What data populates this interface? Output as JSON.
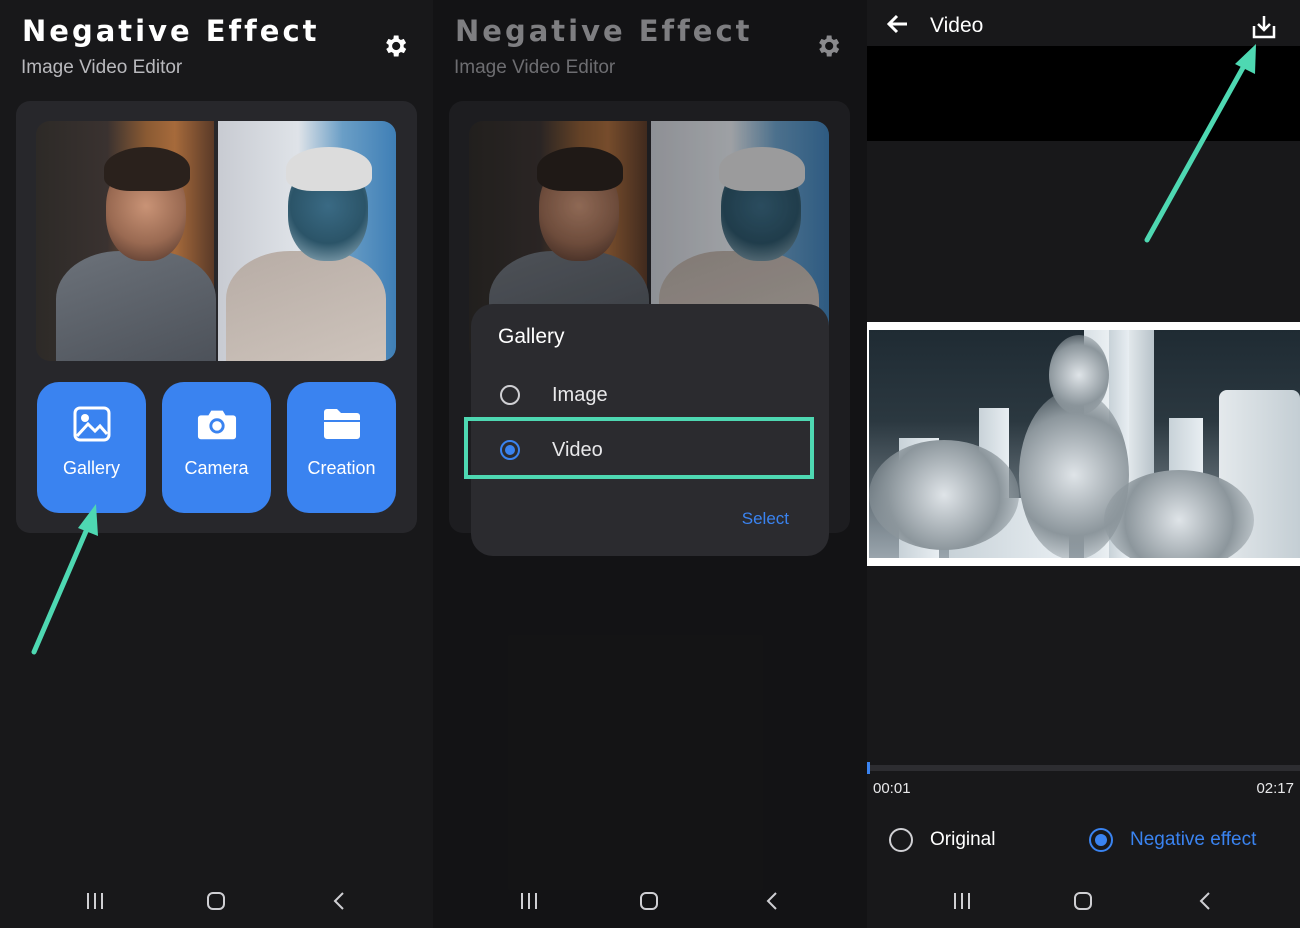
{
  "home": {
    "title": "Negative Effect",
    "subtitle": "Image Video Editor",
    "buttons": [
      "Gallery",
      "Camera",
      "Creation"
    ]
  },
  "dialog": {
    "title": "Gallery",
    "options": [
      "Image",
      "Video"
    ],
    "selected": "Video",
    "action": "Select"
  },
  "player": {
    "title": "Video",
    "current_time": "00:01",
    "total_time": "02:17",
    "progress": 0.008,
    "options": [
      "Original",
      "Negative effect"
    ],
    "selected": "Negative effect"
  },
  "colors": {
    "accent": "#3a83f0",
    "highlight": "#4ed8b2",
    "background": "#18181a"
  },
  "icons": {
    "settings": "gear-icon",
    "gallery": "image-icon",
    "camera": "camera-icon",
    "creation": "folder-icon",
    "back": "back-arrow-icon",
    "download": "download-icon",
    "nav": [
      "recent-apps-icon",
      "home-icon",
      "back-icon"
    ]
  }
}
